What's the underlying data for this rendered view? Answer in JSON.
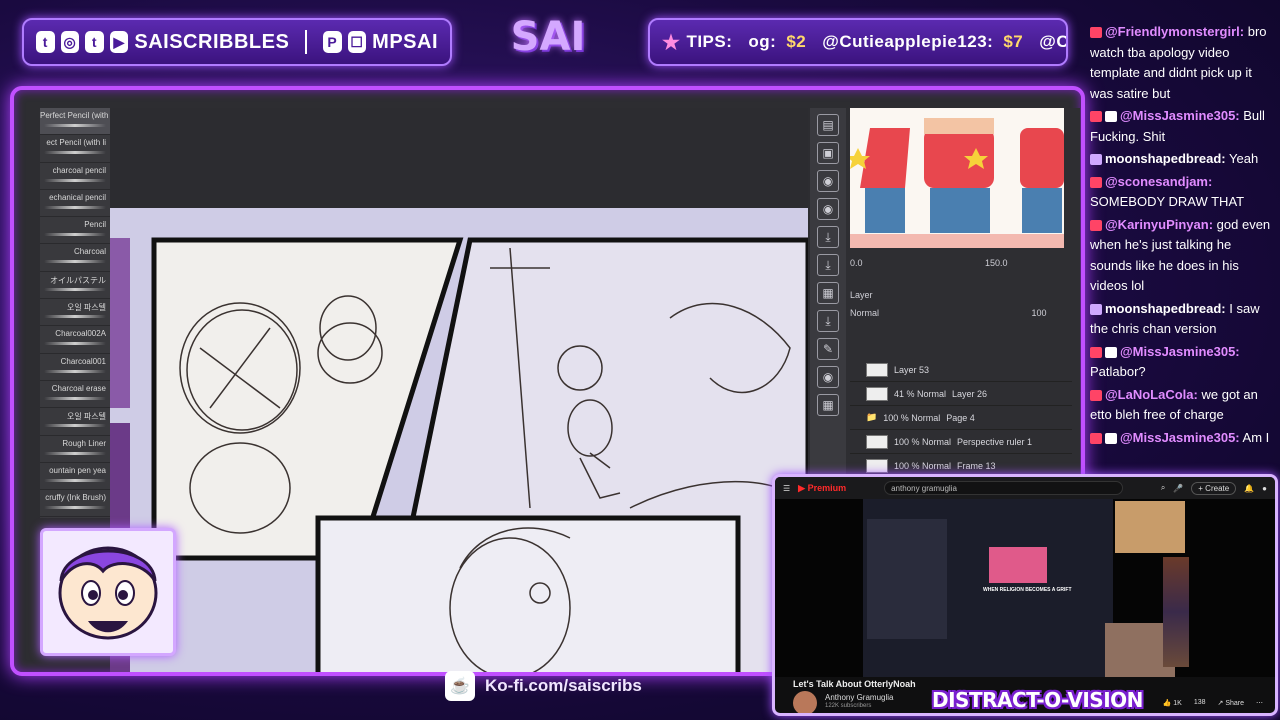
{
  "top_bar": {
    "socials_handle": "SAISCRIBBLES",
    "social_icons": [
      "twitter-icon",
      "instagram-icon",
      "tumblr-icon",
      "youtube-icon"
    ],
    "streaming_icons": [
      "patreon-icon",
      "twitch-icon"
    ],
    "stream_handle": "MPSAI",
    "brand": "SAI",
    "tips_label": "TIPS:",
    "tips": [
      {
        "user": "og:",
        "amount": "$2"
      },
      {
        "user": "@Cutieapplepie123:",
        "amount": "$7"
      },
      {
        "user": "@ChetM",
        "amount": ""
      }
    ]
  },
  "brush_panel": {
    "brushes": [
      "Perfect Pencil (with",
      "ect Pencil (with li",
      "charcoal pencil",
      "echanical pencil",
      "Pencil",
      "Charcoal",
      "オイルパステル",
      "오일 파스텔",
      "Charcoal002A",
      "Charcoal001",
      "Charcoal erase",
      "오일 파스텔",
      "Rough Liner",
      "ountain pen yea",
      "cruffy (Ink Brush)"
    ],
    "active_index": 0
  },
  "right_panel": {
    "tool_icons": [
      "layer-icon",
      "image-icon",
      "camera-icon",
      "camera-icon",
      "download-icon",
      "download-icon",
      "grid-icon",
      "download-icon",
      "edit-icon",
      "camera-icon",
      "grid-icon"
    ],
    "zoom": "150.0",
    "zoom_value": "0.0",
    "layer_tab": "Layer",
    "blend_mode": "Normal",
    "opacity": "100",
    "layers": [
      {
        "opacity": "",
        "name": "Layer 53"
      },
      {
        "opacity": "41 % Normal",
        "name": "Layer 26"
      },
      {
        "opacity": "100 % Normal",
        "name": "Page 4"
      },
      {
        "opacity": "100 % Normal",
        "name": "Perspective ruler 1"
      },
      {
        "opacity": "100 % Normal",
        "name": "Frame 13"
      }
    ]
  },
  "kofi": {
    "link": "Ko-fi.com/saiscribs"
  },
  "chat": [
    {
      "badge": "r",
      "user": "@Friendlymonstergirl:",
      "text": "bro watch tba apology video template and didnt pick up it was satire but"
    },
    {
      "badge": "r",
      "user": "@MissJasmine305:",
      "text": "Bull Fucking. Shit"
    },
    {
      "badge": "p",
      "user": "moonshapedbread:",
      "user_white": true,
      "text": "Yeah"
    },
    {
      "badge": "r",
      "user": "@sconesandjam:",
      "text": "SOMEBODY DRAW THAT"
    },
    {
      "badge": "r",
      "user": "@KarinyuPinyan:",
      "text": "god even when he's just talking he sounds like he does in his videos lol"
    },
    {
      "badge": "p",
      "user": "moonshapedbread:",
      "user_white": true,
      "text": "I saw the chris chan version"
    },
    {
      "badge": "r",
      "user": "@MissJasmine305:",
      "text": "Patlabor?"
    },
    {
      "badge": "r",
      "user": "@LaNoLaCola:",
      "text": "we got an etto bleh free of charge"
    },
    {
      "badge": "r",
      "user": "@MissJasmine305:",
      "text": "Am I"
    }
  ],
  "video": {
    "premium_label": "Premium",
    "search_query": "anthony gramuglia",
    "create_label": "Create",
    "title": "Let's Talk About OtterlyNoah",
    "channel": "Anthony Gramuglia",
    "subscribers": "122K subscribers",
    "likes": "1K",
    "count2": "138",
    "share_label": "Share",
    "thumb_caption": "WHEN RELIGION BECOMES A GRIFT",
    "overlay_title": "DISTRACT-O-VISION"
  }
}
